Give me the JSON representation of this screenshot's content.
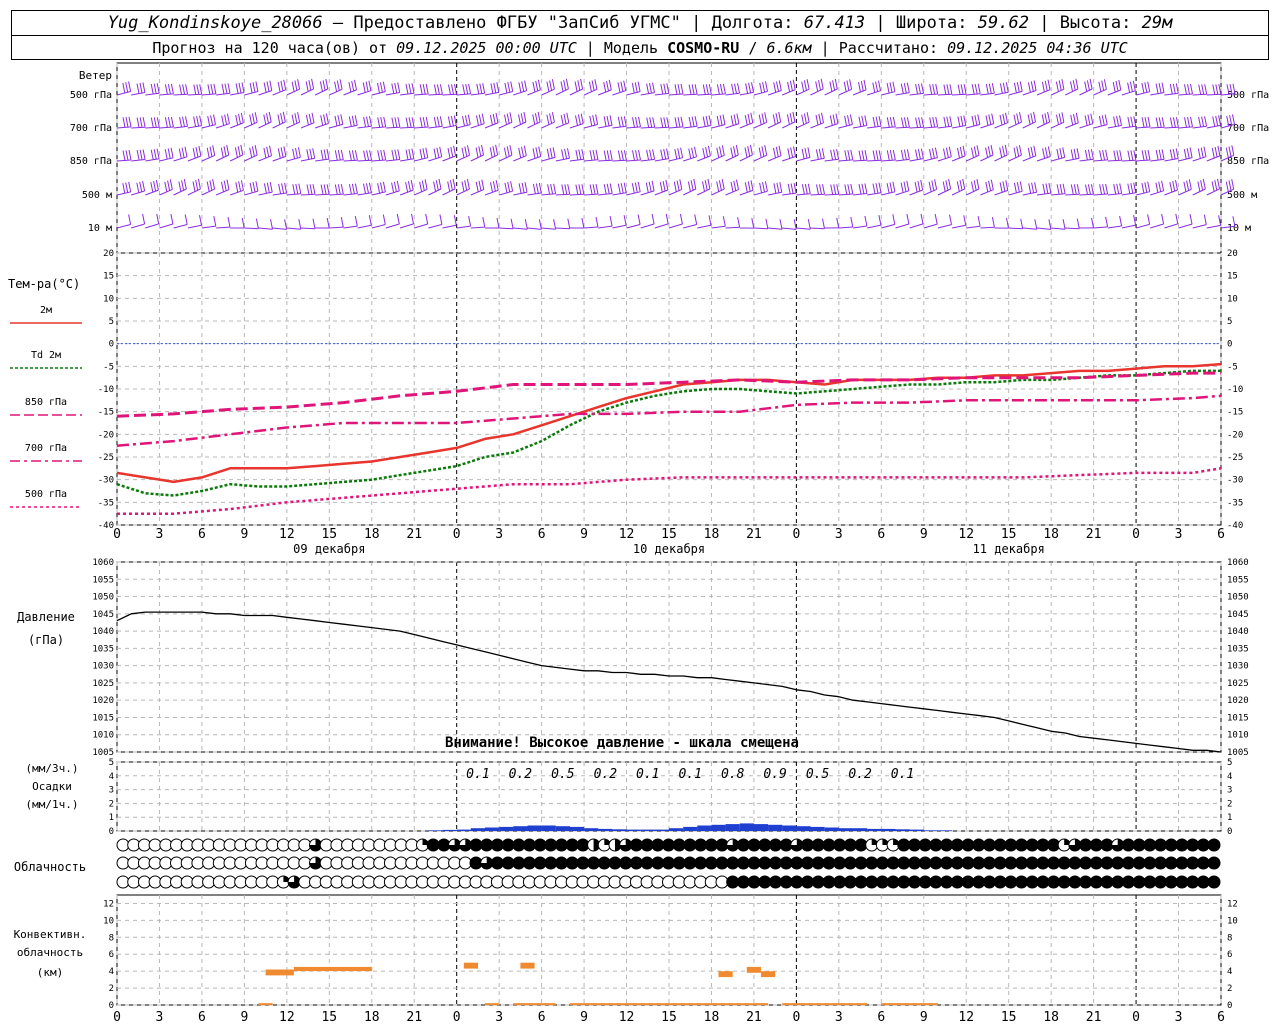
{
  "header": {
    "station": "Yug_Kondinskoye_28066",
    "provider": "– Предоставлено ФГБУ \"ЗапСиб УГМС\"",
    "lon_label": "Долгота:",
    "lon": "67.413",
    "lat_label": "Широта:",
    "lat": "59.62",
    "alt_label": "Высота:",
    "alt": "29м",
    "forecast_prefix": "Прогноз на 120 часа(ов) от",
    "forecast_date": "09.12.2025 00:00 UTC",
    "model_label": "Модель",
    "model": "COSMO-RU",
    "model_res": "6.6км",
    "calc_label": "Рассчитано:",
    "calc_date": "09.12.2025 04:36 UTC"
  },
  "time_axis": {
    "hour_labels": [
      "0",
      "3",
      "6",
      "9",
      "12",
      "15",
      "18",
      "21",
      "0",
      "3",
      "6",
      "9",
      "12",
      "15",
      "18",
      "21",
      "0",
      "3",
      "6",
      "9",
      "12",
      "15",
      "18",
      "21",
      "0",
      "3",
      "6"
    ],
    "day_labels": [
      {
        "text": "09 декабря",
        "hour": 15
      },
      {
        "text": "10 декабря",
        "hour": 39
      },
      {
        "text": "11 декабря",
        "hour": 63
      }
    ],
    "midnights": [
      24,
      48,
      72,
      96
    ]
  },
  "wind": {
    "title": "Ветер",
    "levels": [
      "500 гПа",
      "700 гПа",
      "850 гПа",
      "500 м",
      "10  м"
    ],
    "color": "#8b2be2"
  },
  "chart_data": [
    {
      "type": "line",
      "name": "temperature",
      "title": "Тем-ра(°C)",
      "ylim": [
        -40,
        20
      ],
      "yticks": [
        20,
        15,
        10,
        5,
        0,
        -5,
        -10,
        -15,
        -20,
        -25,
        -30,
        -35,
        -40
      ],
      "legend": [
        {
          "label": "2м",
          "color": "#e8352d"
        },
        {
          "label": "Td  2м",
          "color": "#0b7a0b"
        },
        {
          "label": "850 гПа",
          "color": "#e0157a"
        },
        {
          "label": "700 гПа",
          "color": "#e0157a"
        },
        {
          "label": "500 гПа",
          "color": "#e0157a"
        }
      ],
      "series": [
        {
          "name": "2м",
          "color": "#e8352d",
          "x": [
            0,
            2,
            4,
            6,
            8,
            10,
            12,
            14,
            16,
            18,
            20,
            22,
            24,
            26,
            28,
            30,
            32,
            34,
            36,
            38,
            40,
            42,
            44,
            46,
            48,
            50,
            52,
            54,
            56,
            58,
            60,
            62,
            64,
            66,
            68,
            70,
            72,
            74,
            76,
            78
          ],
          "y": [
            -28.5,
            -29.5,
            -30.5,
            -29.5,
            -27.5,
            -27.5,
            -27.5,
            -27,
            -26.5,
            -26,
            -25,
            -24,
            -23,
            -21,
            -20,
            -18,
            -16,
            -14,
            -12,
            -10.5,
            -9,
            -8.5,
            -8,
            -8,
            -8.5,
            -9,
            -8,
            -8,
            -8,
            -7.5,
            -7.5,
            -7,
            -7,
            -6.5,
            -6,
            -6,
            -5.5,
            -5,
            -5,
            -4.5
          ]
        },
        {
          "name": "Td  2м",
          "color": "#0b7a0b",
          "x": [
            0,
            2,
            4,
            6,
            8,
            10,
            12,
            14,
            16,
            18,
            20,
            22,
            24,
            26,
            28,
            30,
            32,
            34,
            36,
            38,
            40,
            42,
            44,
            46,
            48,
            50,
            52,
            54,
            56,
            58,
            60,
            62,
            64,
            66,
            68,
            70,
            72,
            74,
            76,
            78
          ],
          "y": [
            -31,
            -33,
            -33.5,
            -32.5,
            -31,
            -31.5,
            -31.5,
            -31,
            -30.5,
            -30,
            -29,
            -28,
            -27,
            -25,
            -24,
            -21.5,
            -18,
            -15,
            -13,
            -11.5,
            -10.5,
            -10,
            -10,
            -10.5,
            -11,
            -10.5,
            -10,
            -9.5,
            -9,
            -9,
            -8.5,
            -8.5,
            -8,
            -8,
            -7.5,
            -7,
            -7,
            -6.5,
            -6,
            -6
          ]
        },
        {
          "name": "850 гПа",
          "color": "#e0157a",
          "dash": "12,5",
          "x": [
            0,
            4,
            8,
            12,
            16,
            20,
            24,
            28,
            32,
            36,
            40,
            44,
            48,
            52,
            56,
            60,
            64,
            68,
            72,
            76,
            78
          ],
          "y": [
            -16,
            -15.5,
            -14.5,
            -14,
            -13,
            -11.5,
            -10.5,
            -9,
            -9,
            -9,
            -8.5,
            -8,
            -8.5,
            -8,
            -8,
            -7.5,
            -7.5,
            -7.5,
            -7,
            -6.5,
            -6.5
          ]
        },
        {
          "name": "700 гПа",
          "color": "#e0157a",
          "dash": "12,4,3,4",
          "x": [
            0,
            4,
            8,
            12,
            16,
            20,
            24,
            28,
            32,
            36,
            40,
            44,
            48,
            52,
            56,
            60,
            64,
            68,
            72,
            76,
            78
          ],
          "y": [
            -22.5,
            -21.5,
            -20,
            -18.5,
            -17.5,
            -17.5,
            -17.5,
            -16.5,
            -15.5,
            -15.5,
            -15,
            -15,
            -13.5,
            -13,
            -13,
            -12.5,
            -12.5,
            -12.5,
            -12.5,
            -12,
            -11.5
          ]
        },
        {
          "name": "500 гПа",
          "color": "#e0157a",
          "dash": "3,3",
          "x": [
            0,
            4,
            8,
            12,
            16,
            20,
            24,
            28,
            32,
            36,
            40,
            44,
            48,
            52,
            56,
            60,
            64,
            68,
            72,
            76,
            78
          ],
          "y": [
            -37.5,
            -37.5,
            -36.5,
            -35,
            -34,
            -33,
            -32,
            -31,
            -31,
            -30,
            -29.5,
            -29.5,
            -29.5,
            -29.5,
            -29.5,
            -29.5,
            -29.5,
            -29,
            -28.5,
            -28.5,
            -27.5
          ]
        }
      ]
    },
    {
      "type": "line",
      "name": "pressure",
      "title": "Давление",
      "unit": "(гПа)",
      "ylim": [
        1005,
        1060
      ],
      "yticks": [
        1060,
        1055,
        1050,
        1045,
        1040,
        1035,
        1030,
        1025,
        1020,
        1015,
        1010,
        1005
      ],
      "annotation": "Внимание! Высокое давление - шкала смещена",
      "series": [
        {
          "name": "pressure",
          "color": "#000000",
          "x": [
            0,
            1,
            2,
            3,
            4,
            5,
            6,
            7,
            8,
            9,
            10,
            11,
            12,
            13,
            14,
            15,
            16,
            17,
            18,
            19,
            20,
            21,
            22,
            23,
            24,
            25,
            26,
            27,
            28,
            29,
            30,
            31,
            32,
            33,
            34,
            35,
            36,
            37,
            38,
            39,
            40,
            41,
            42,
            43,
            44,
            45,
            46,
            47,
            48,
            49,
            50,
            51,
            52,
            53,
            54,
            55,
            56,
            57,
            58,
            59,
            60,
            61,
            62,
            63,
            64,
            65,
            66,
            67,
            68,
            69,
            70,
            71,
            72,
            73,
            74,
            75,
            76,
            77,
            78
          ],
          "y": [
            1043,
            1045,
            1045.5,
            1045.5,
            1045.5,
            1045.5,
            1045.5,
            1045,
            1045,
            1044.5,
            1044.5,
            1044.5,
            1044,
            1043.5,
            1043,
            1042.5,
            1042,
            1041.5,
            1041,
            1040.5,
            1040,
            1039,
            1038,
            1037,
            1036,
            1035,
            1034,
            1033,
            1032,
            1031,
            1030,
            1029.5,
            1029,
            1028.5,
            1028.5,
            1028,
            1028,
            1027.5,
            1027.5,
            1027,
            1027,
            1026.5,
            1026.5,
            1026,
            1025.5,
            1025,
            1024.5,
            1024,
            1023,
            1022.5,
            1021.5,
            1021,
            1020,
            1019.5,
            1019,
            1018.5,
            1018,
            1017.5,
            1017,
            1016.5,
            1016,
            1015.5,
            1015,
            1014,
            1013,
            1012,
            1011,
            1010.5,
            1009.5,
            1009,
            1008.5,
            1008,
            1007.5,
            1007,
            1006.5,
            1006,
            1005.5,
            1005.5,
            1005
          ]
        }
      ]
    },
    {
      "type": "bar",
      "name": "precipitation",
      "title": "Осадки",
      "unit_top": "(мм/3ч.)",
      "unit_bottom": "(мм/1ч.)",
      "ylim": [
        0,
        5
      ],
      "yticks": [
        5,
        4,
        3,
        2,
        1,
        0
      ],
      "color": "#1f3fd1",
      "totals_3h": [
        {
          "hour": 24,
          "value": "0.1"
        },
        {
          "hour": 27,
          "value": "0.2"
        },
        {
          "hour": 30,
          "value": "0.5"
        },
        {
          "hour": 33,
          "value": "0.2"
        },
        {
          "hour": 36,
          "value": "0.1"
        },
        {
          "hour": 39,
          "value": "0.1"
        },
        {
          "hour": 42,
          "value": "0.8"
        },
        {
          "hour": 45,
          "value": "0.9"
        },
        {
          "hour": 48,
          "value": "0.5"
        },
        {
          "hour": 51,
          "value": "0.2"
        },
        {
          "hour": 54,
          "value": "0.1"
        }
      ],
      "hourly_x": [
        22,
        23,
        24,
        25,
        26,
        27,
        28,
        29,
        30,
        31,
        32,
        33,
        34,
        35,
        36,
        37,
        38,
        39,
        40,
        41,
        42,
        43,
        44,
        45,
        46,
        47,
        48,
        49,
        50,
        51,
        52,
        53,
        54,
        55,
        56,
        57,
        58
      ],
      "hourly_y": [
        0.05,
        0.08,
        0.1,
        0.2,
        0.25,
        0.3,
        0.35,
        0.4,
        0.4,
        0.35,
        0.3,
        0.2,
        0.15,
        0.12,
        0.1,
        0.1,
        0.1,
        0.2,
        0.3,
        0.4,
        0.45,
        0.5,
        0.55,
        0.5,
        0.45,
        0.4,
        0.35,
        0.3,
        0.25,
        0.2,
        0.2,
        0.15,
        0.15,
        0.12,
        0.1,
        0.05,
        0.05
      ]
    },
    {
      "type": "bar",
      "name": "convective_cloud",
      "title": "Конвективн.",
      "title2": "облачность",
      "unit": "(км)",
      "ylim": [
        0,
        13
      ],
      "yticks": [
        12,
        10,
        8,
        6,
        4,
        2,
        0
      ],
      "color": "#f08a30",
      "segments": [
        {
          "x0": 10.5,
          "x1": 12.5,
          "y0": 3.5,
          "y1": 4.2
        },
        {
          "x0": 12.5,
          "x1": 18,
          "y0": 4.0,
          "y1": 4.5
        },
        {
          "x0": 24.5,
          "x1": 25.5,
          "y0": 4.3,
          "y1": 5.0
        },
        {
          "x0": 28.5,
          "x1": 29.5,
          "y0": 4.3,
          "y1": 5.0
        },
        {
          "x0": 42.5,
          "x1": 43.5,
          "y0": 3.3,
          "y1": 4.0
        },
        {
          "x0": 44.5,
          "x1": 45.5,
          "y0": 3.8,
          "y1": 4.5
        },
        {
          "x0": 45.5,
          "x1": 46.5,
          "y0": 3.3,
          "y1": 4.0
        }
      ],
      "base_segments": [
        [
          10,
          11
        ],
        [
          26,
          27
        ],
        [
          28,
          31
        ],
        [
          32,
          46
        ],
        [
          47,
          53
        ],
        [
          54,
          58
        ]
      ]
    }
  ],
  "cloudiness": {
    "title": "Облачность",
    "rows": [
      "0000000000000000003000000000144334444444444421234444444443444443444444111444444444444444134443444444444",
      "0000000000000000003000000000000004344444444444444444444444444444444444444444444444444444444444444444444",
      "0000000000000001300000000000000000000000000000000000000004444444444444444444444444444444444444444444444"
    ]
  }
}
